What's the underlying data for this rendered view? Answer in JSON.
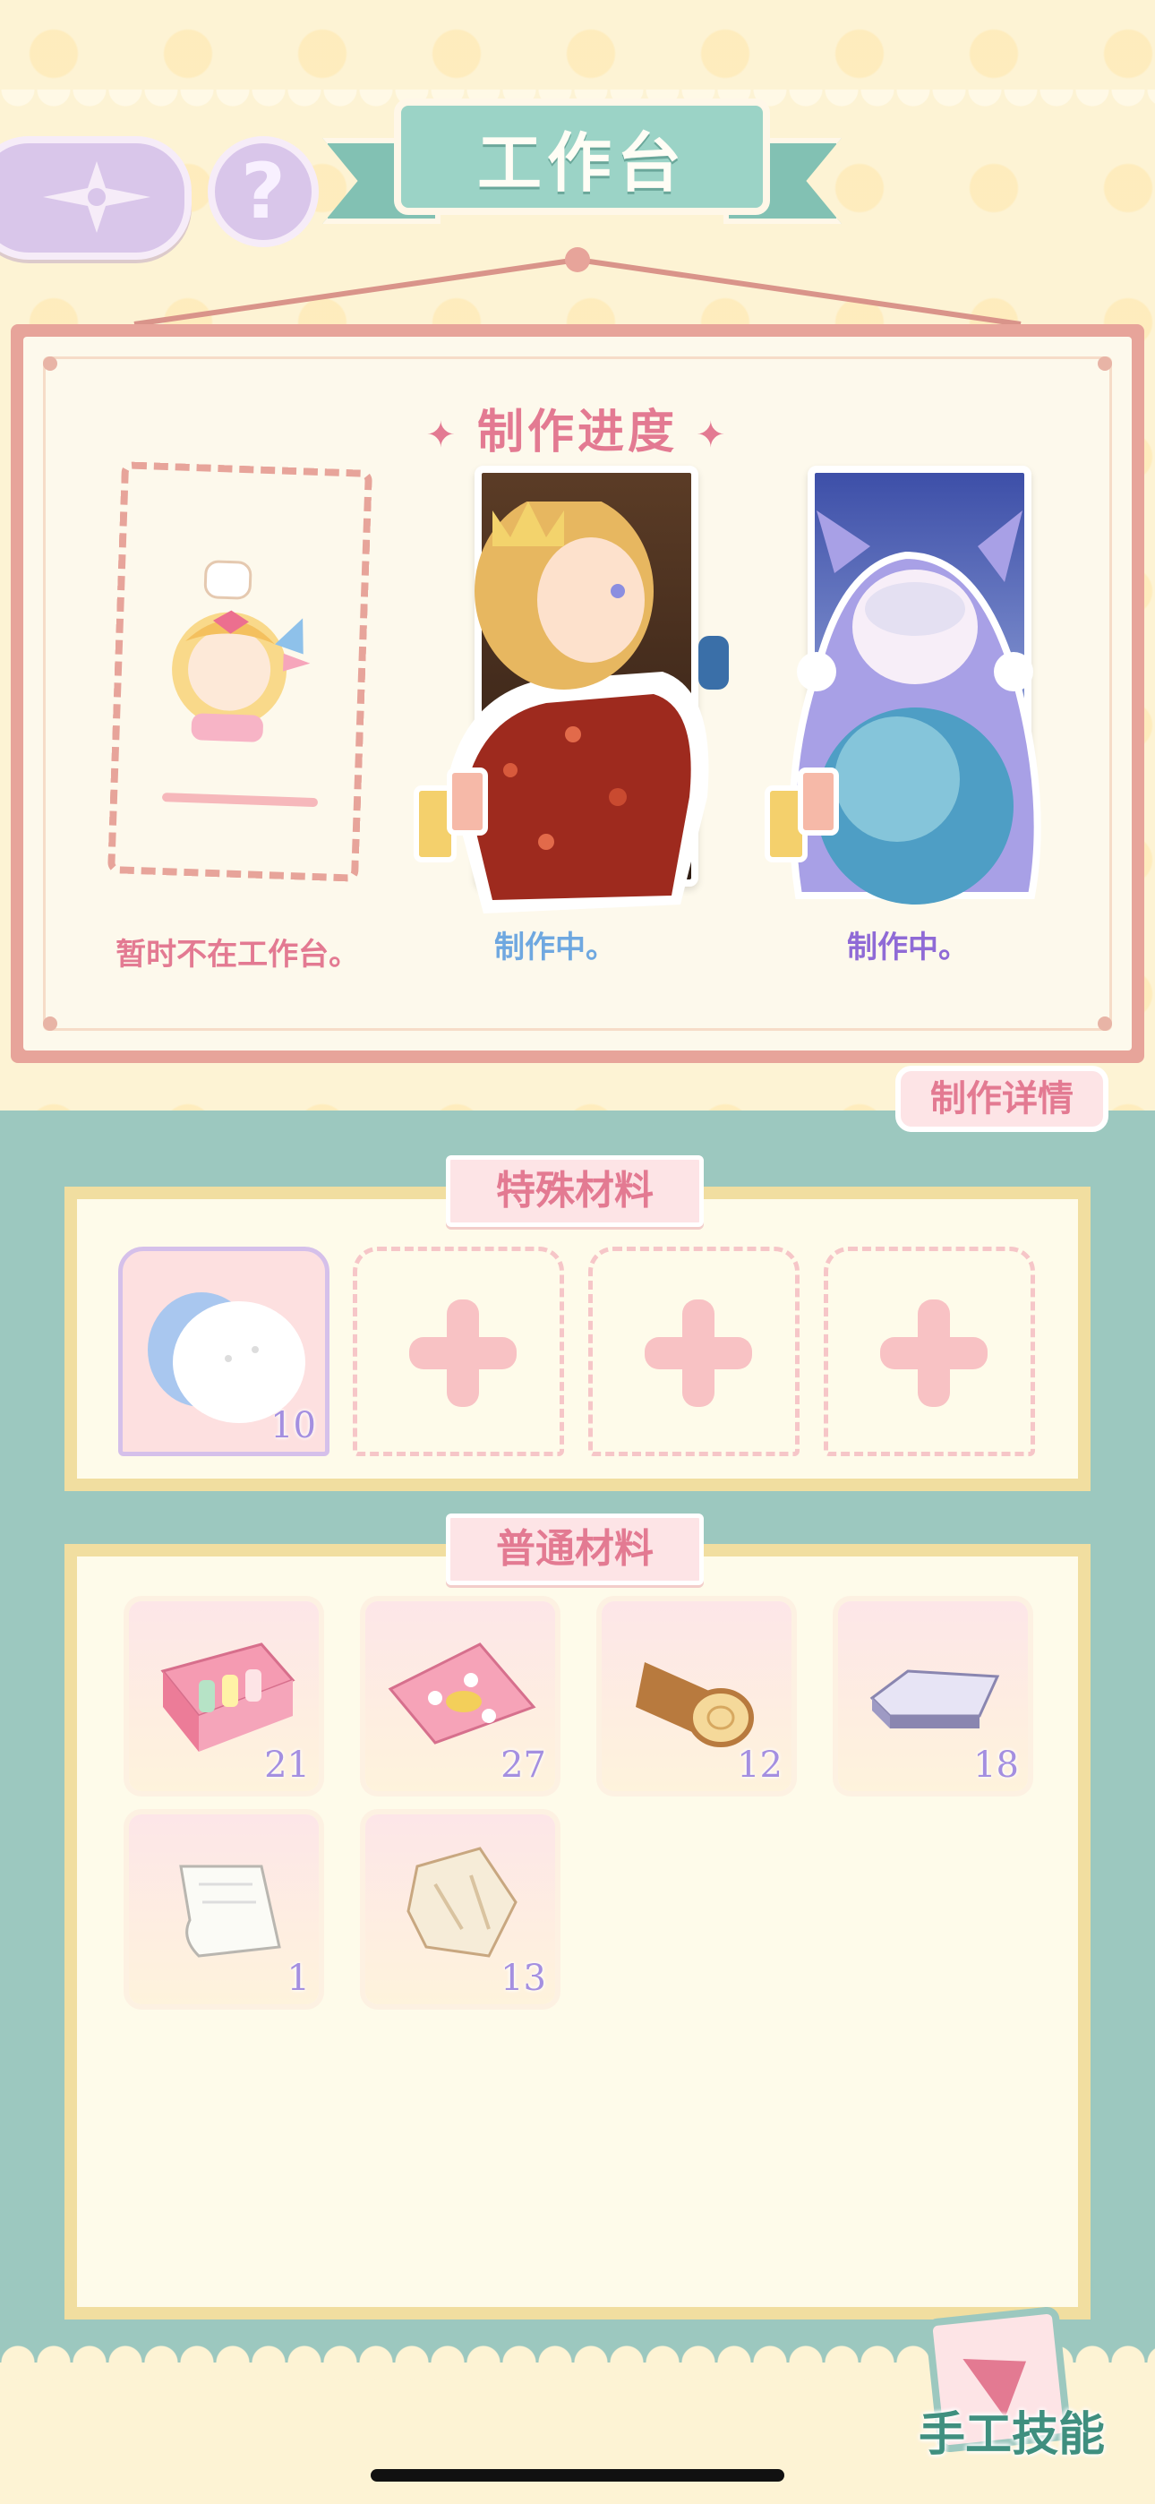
{
  "header": {
    "title": "工作台",
    "back_icon": "compass-star-icon",
    "help_label": "?"
  },
  "progress": {
    "title": "制作进度",
    "slots": [
      {
        "status": "暂时不在工作台。",
        "status_color": "#e37a92"
      },
      {
        "status": "制作中。",
        "status_color": "#6fa8e0"
      },
      {
        "status": "制作中。",
        "status_color": "#8f6ad6"
      }
    ],
    "detail_button": "制作详情"
  },
  "special_materials": {
    "label": "特殊材料",
    "items": [
      {
        "icon": "cotton-cloud-icon",
        "count": "10"
      }
    ]
  },
  "normal_materials": {
    "label": "普通材料",
    "items": [
      {
        "icon": "thread-box-icon",
        "count": "21"
      },
      {
        "icon": "pink-fabric-icon",
        "count": "27"
      },
      {
        "icon": "wood-log-icon",
        "count": "12"
      },
      {
        "icon": "metal-ingot-icon",
        "count": "18"
      },
      {
        "icon": "paper-sheet-icon",
        "count": "1"
      },
      {
        "icon": "fur-pelt-icon",
        "count": "13"
      }
    ]
  },
  "skill_button": {
    "label": "手工技能"
  }
}
